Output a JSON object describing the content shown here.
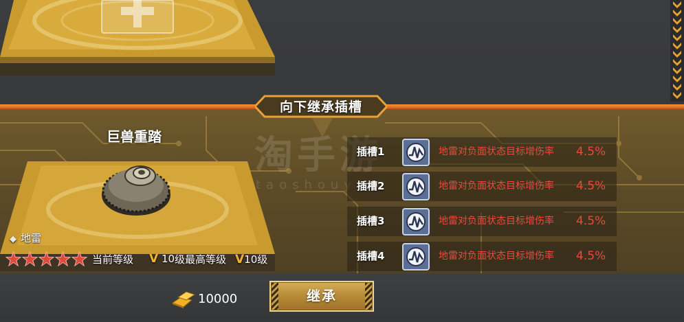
{
  "header": {
    "title": "向下继承插槽"
  },
  "item": {
    "name": "巨兽重踏",
    "type_label": "地雷",
    "stars": 5,
    "current_level_label": "当前等级",
    "current_level": "10",
    "max_level_label": "级最高等级",
    "max_level": "10级",
    "v_mark": "V"
  },
  "slots": [
    {
      "label": "插槽1",
      "desc": "地雷对负面状态目标增伤率",
      "value": "4.5%"
    },
    {
      "label": "插槽2",
      "desc": "地雷对负面状态目标增伤率",
      "value": "4.5%"
    },
    {
      "label": "插槽3",
      "desc": "地雷对负面状态目标增伤率",
      "value": "4.5%"
    },
    {
      "label": "插槽4",
      "desc": "地雷对负面状态目标增伤率",
      "value": "4.5%"
    }
  ],
  "footer": {
    "cost": "10000",
    "inherit_label": "继承"
  },
  "colors": {
    "accent_orange": "#e8701e",
    "gold": "#c9a04a",
    "slot_text_red": "#e84a3e",
    "star_red": "#e0483a"
  },
  "icons": {
    "add": "plus-icon",
    "slot": "wave-slot-icon",
    "cost": "gold-bar-icon",
    "star": "star-icon"
  }
}
